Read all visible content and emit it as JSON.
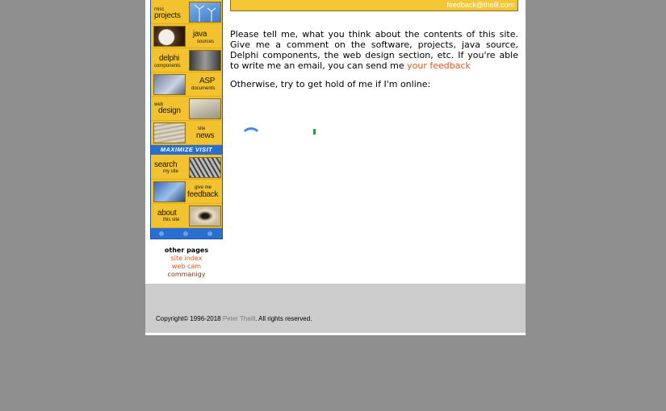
{
  "nav": {
    "rows": [
      {
        "small": "misc",
        "big": "projects",
        "side": "left"
      },
      {
        "small": "sources",
        "big": "java",
        "side": "right"
      },
      {
        "small": "components",
        "big": "delphi",
        "side": "left"
      },
      {
        "small": "documents",
        "big": "ASP",
        "side": "right"
      },
      {
        "small": "web",
        "big": "design",
        "side": "left"
      },
      {
        "small": "site",
        "big": "news",
        "side": "right"
      }
    ],
    "banner": "MAXIMIZE VISIT",
    "rows2": [
      {
        "small": "my site",
        "big": "search",
        "side": "left"
      },
      {
        "small": "give me",
        "big": "feedback",
        "side": "right"
      },
      {
        "small": "this site",
        "big": "about",
        "side": "left"
      }
    ]
  },
  "other_pages": {
    "heading": "other pages",
    "links": [
      "site index",
      "web cam",
      "commanigy"
    ]
  },
  "topbar": {
    "email": "feedback@theill.com"
  },
  "content": {
    "para1_text": "Please tell me, what you think about the contents of this site. Give me a comment on the software, projects, java source, Delphi components, the web design section, etc. If you're able to write me an email, you can send me ",
    "feedback_link": "your feedback",
    "para2": "Otherwise, try to get hold of me if I'm online:"
  },
  "footer": {
    "copyright_prefix": "Copyright© 1996-2018 ",
    "author": "Peter Theill",
    "copyright_suffix": ". All rights reserved."
  },
  "colors": {
    "accent_link": "#e0551c",
    "nav_yellow": "#f2c230",
    "nav_blue": "#2a6fcf",
    "spinner_blue": "#4a86e8",
    "status_green": "#2e9e44"
  }
}
